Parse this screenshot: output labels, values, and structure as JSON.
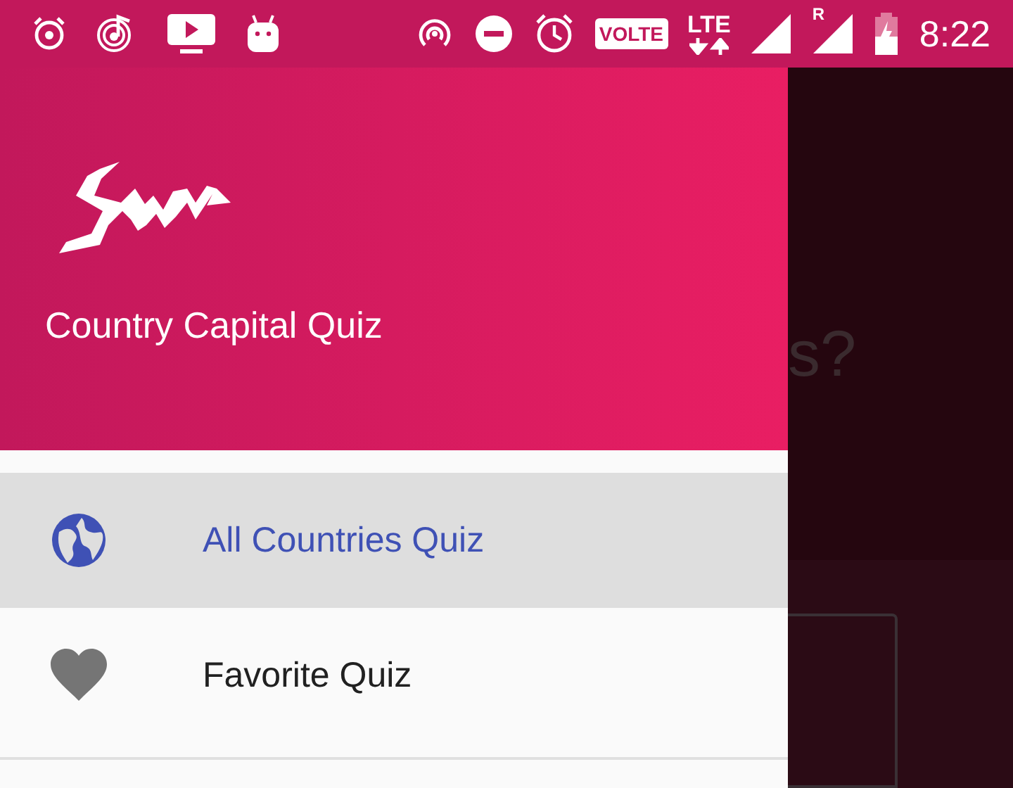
{
  "status_bar": {
    "volte": "VOLTE",
    "network": "LTE",
    "roaming": "R",
    "time": "8:22"
  },
  "drawer": {
    "title": "Country Capital Quiz",
    "items": [
      {
        "label": "All Countries Quiz",
        "kind": "globe",
        "selected": true
      },
      {
        "label": "Favorite Quiz",
        "kind": "heart",
        "selected": false
      }
    ]
  },
  "background": {
    "question_fragment": "s?"
  }
}
